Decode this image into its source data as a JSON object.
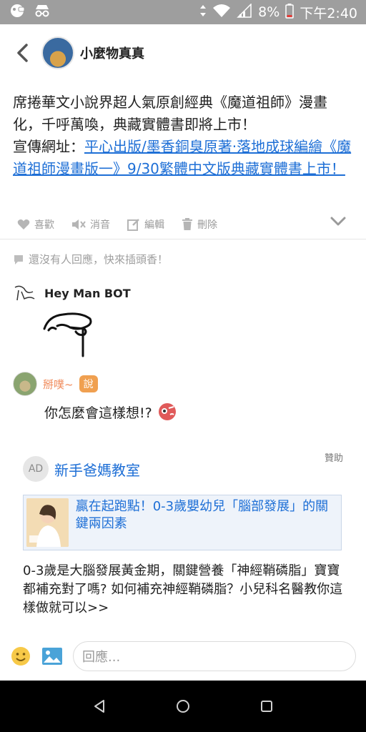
{
  "status_bar": {
    "battery_percent": "8%",
    "time": "下午2:40",
    "icons": [
      "notification-icon",
      "privacy-icon",
      "data-arrows-icon",
      "wifi-icon",
      "signal-icon",
      "battery-icon"
    ]
  },
  "header": {
    "author_name": "小麼物真真",
    "icons": [
      "back-icon"
    ]
  },
  "post": {
    "text_line1": "席捲華文小說界超人氣原創經典《魔道祖師》漫畫化，千呼萬喚，典藏實體書即將上市！",
    "promo_prefix": "宣傳網址：",
    "promo_link": "平心出版/墨香銅臭原著‧落地成球編繪《魔道祖師漫畫版一》9/30繁體中文版典藏實體書上市！"
  },
  "actions": {
    "like": "喜歡",
    "mute": "消音",
    "edit": "編輯",
    "delete": "刪除"
  },
  "no_reply_text": "還沒有人回應，快來插頭香！",
  "bot": {
    "name": "Hey Man BOT"
  },
  "comment": {
    "username": "掰噗~",
    "badge": "說",
    "text": "你怎麼會這樣想!?"
  },
  "ad": {
    "label": "贊助",
    "avatar_text": "AD",
    "title": "新手爸媽教室",
    "card_title": "贏在起跑點！0-3歲嬰幼兒「腦部發展」的關鍵兩因素",
    "description": "0-3歲是大腦發展黃金期，關鍵營養「神經鞘磷脂」寶寶都補充對了嗎? 如何補充神經鞘磷脂？小兒科名醫教你這樣做就可以>>"
  },
  "reply_bar": {
    "placeholder": "回應..."
  },
  "colors": {
    "link": "#1e6fd6",
    "status_bar": "#9e9e9e",
    "accent_orange": "#f0a050",
    "muted": "#9a9a9a"
  }
}
